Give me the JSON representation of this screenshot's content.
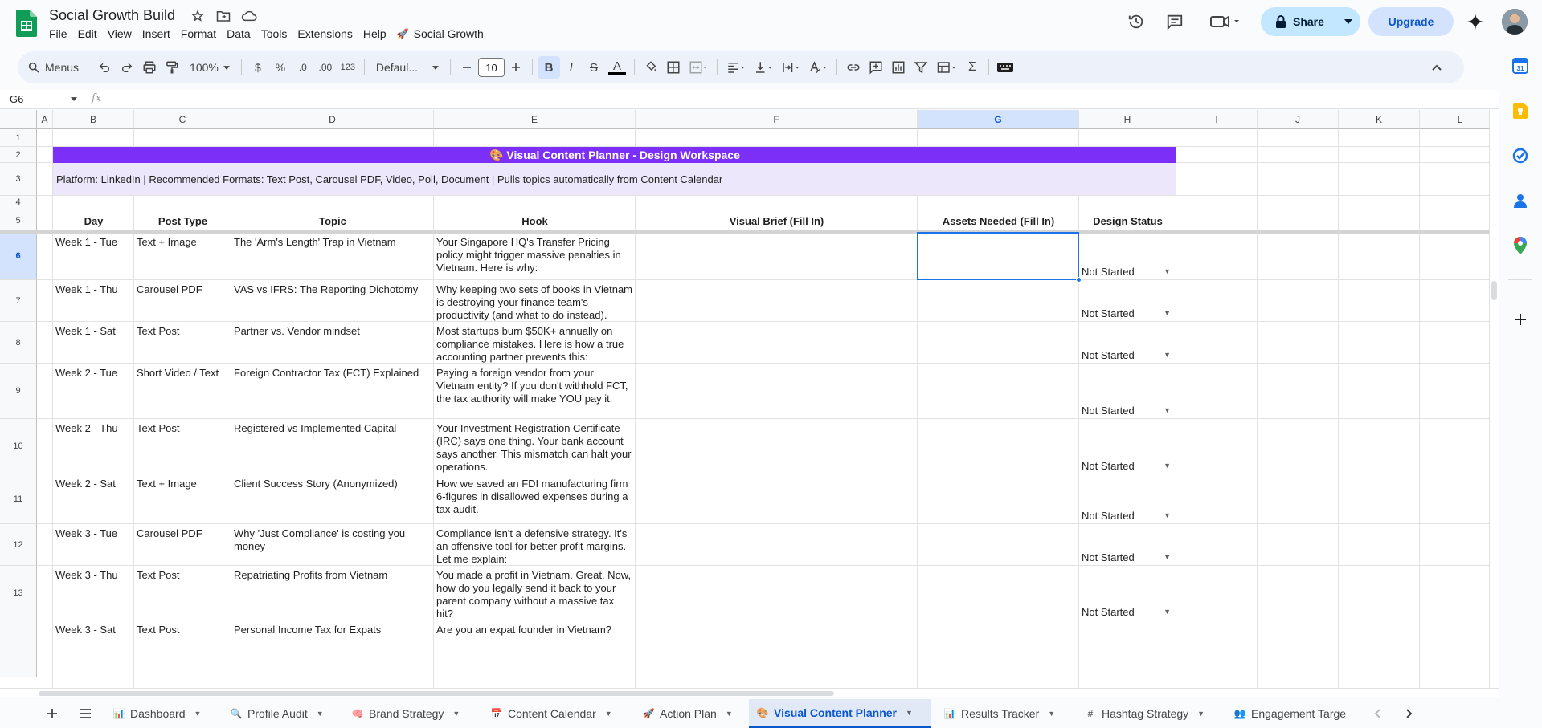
{
  "app": {
    "doc_title": "Social Growth Build",
    "menu": [
      "File",
      "Edit",
      "View",
      "Insert",
      "Format",
      "Data",
      "Tools",
      "Extensions",
      "Help"
    ],
    "extension_menu": "Social Growth",
    "share_label": "Share",
    "upgrade_label": "Upgrade"
  },
  "toolbar": {
    "search_label": "Menus",
    "zoom": "100%",
    "currency": "$",
    "percent": "%",
    "dec_decrease": ".0",
    "dec_increase": ".00",
    "number_format": "123",
    "font": "Defaul...",
    "font_size": "10",
    "bold": "B",
    "italic": "I",
    "strike": "S",
    "text_color": "A",
    "sum": "Σ"
  },
  "formula_bar": {
    "cell_ref": "G6",
    "fx": "fx"
  },
  "sheet": {
    "columns": [
      "A",
      "B",
      "C",
      "D",
      "E",
      "F",
      "G",
      "H",
      "I",
      "J",
      "K",
      "L"
    ],
    "selected_column": "G",
    "row_numbers": [
      "1",
      "2",
      "3",
      "4",
      "5",
      "6",
      "7",
      "8",
      "9",
      "10",
      "11",
      "12",
      "13",
      ""
    ],
    "title": "🎨 Visual Content Planner - Design Workspace",
    "subtitle": "Platform: LinkedIn | Recommended Formats: Text Post, Carousel PDF, Video, Poll, Document | Pulls topics automatically from Content Calendar",
    "headers": [
      "Day",
      "Post Type",
      "Topic",
      "Hook",
      "Visual Brief (Fill In)",
      "Assets Needed (Fill In)",
      "Design Status"
    ],
    "rows": [
      {
        "day": "Week 1 - Tue",
        "type": "Text + Image",
        "topic": "The 'Arm's Length' Trap in Vietnam",
        "hook": "Your Singapore HQ's Transfer Pricing policy might trigger massive penalties in Vietnam. Here is why:",
        "status": "Not Started"
      },
      {
        "day": "Week 1 - Thu",
        "type": "Carousel PDF",
        "topic": "VAS vs IFRS: The Reporting Dichotomy",
        "hook": "Why keeping two sets of books in Vietnam is destroying your finance team's productivity (and what to do instead).",
        "status": "Not Started"
      },
      {
        "day": "Week 1 - Sat",
        "type": "Text Post",
        "topic": "Partner vs. Vendor mindset",
        "hook": "Most startups burn $50K+ annually on compliance mistakes. Here is how a true accounting partner prevents this:",
        "status": "Not Started"
      },
      {
        "day": "Week 2 - Tue",
        "type": "Short Video / Text",
        "topic": "Foreign Contractor Tax (FCT) Explained",
        "hook": "Paying a foreign vendor from your Vietnam entity? If you don't withhold FCT, the tax authority will make YOU pay it.",
        "status": "Not Started"
      },
      {
        "day": "Week 2 - Thu",
        "type": "Text Post",
        "topic": "Registered vs Implemented Capital",
        "hook": "Your Investment Registration Certificate (IRC) says one thing. Your bank account says another. This mismatch can halt your operations.",
        "status": "Not Started"
      },
      {
        "day": "Week 2 - Sat",
        "type": "Text + Image",
        "topic": "Client Success Story (Anonymized)",
        "hook": "How we saved an FDI manufacturing firm 6-figures in disallowed expenses during a tax audit.",
        "status": "Not Started"
      },
      {
        "day": "Week 3 - Tue",
        "type": "Carousel PDF",
        "topic": "Why 'Just Compliance' is costing you money",
        "hook": "Compliance isn't a defensive strategy. It's an offensive tool for better profit margins. Let me explain:",
        "status": "Not Started"
      },
      {
        "day": "Week 3 - Thu",
        "type": "Text Post",
        "topic": "Repatriating Profits from Vietnam",
        "hook": "You made a profit in Vietnam. Great. Now, how do you legally send it back to your parent company without a massive tax hit?",
        "status": "Not Started"
      },
      {
        "day": "Week 3 - Sat",
        "type": "Text Post",
        "topic": "Personal Income Tax for Expats",
        "hook": "Are you an expat founder in Vietnam?",
        "status": ""
      }
    ]
  },
  "tabs": [
    {
      "label": "Dashboard",
      "icon": "📊"
    },
    {
      "label": "Profile Audit",
      "icon": "🔍"
    },
    {
      "label": "Brand Strategy",
      "icon": "🧠"
    },
    {
      "label": "Content Calendar",
      "icon": "📅"
    },
    {
      "label": "Action Plan",
      "icon": "🚀"
    },
    {
      "label": "Visual Content Planner",
      "icon": "🎨"
    },
    {
      "label": "Results Tracker",
      "icon": "📊"
    },
    {
      "label": "Hashtag Strategy",
      "icon": "#"
    },
    {
      "label": "Engagement Targe",
      "icon": "👥"
    }
  ],
  "active_tab": "Visual Content Planner",
  "colors": {
    "title_band": "#7b2ff7",
    "subtitle_band": "#ede7fb",
    "accent": "#0b57d0",
    "share_bg": "#c2e7ff"
  }
}
